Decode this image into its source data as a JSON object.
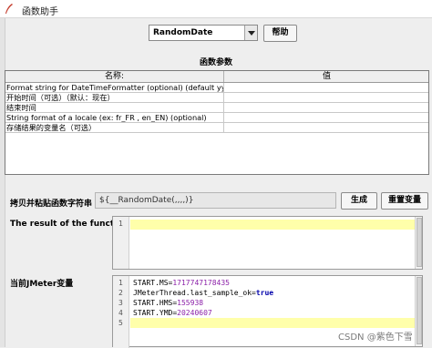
{
  "window": {
    "title": "函数助手"
  },
  "function_selector": {
    "selected": "RandomDate",
    "help_label": "帮助"
  },
  "params": {
    "heading": "函数参数",
    "columns": [
      "名称:",
      "值"
    ],
    "rows": [
      {
        "name": "Format string for DateTimeFormatter (optional) (default yyyy-M...",
        "value": ""
      },
      {
        "name": "开始时间（可选）（默认：现在）",
        "value": ""
      },
      {
        "name": "结束时间",
        "value": ""
      },
      {
        "name": "String format of a locale (ex: fr_FR , en_EN) (optional)",
        "value": ""
      },
      {
        "name": "存储结果的变量名（可选）",
        "value": ""
      }
    ]
  },
  "copy": {
    "label": "拷贝并粘贴函数字符串",
    "value": "${__RandomDate(,,,,)}",
    "generate_label": "生成",
    "reset_label": "重置变量"
  },
  "result": {
    "label": "The result of the function is",
    "line_numbers": [
      "1"
    ],
    "lines": [
      ""
    ]
  },
  "vars": {
    "label": "当前JMeter变量",
    "line_numbers": [
      "1",
      "2",
      "3",
      "4",
      "5"
    ],
    "lines": [
      {
        "key": "START.MS=",
        "value": "1717747178435"
      },
      {
        "key": "JMeterThread.last_sample_ok=",
        "value": "true"
      },
      {
        "key": "START.HMS=",
        "value": "155938"
      },
      {
        "key": "START.YMD=",
        "value": "20240607"
      },
      {
        "key": "",
        "value": ""
      }
    ]
  },
  "watermark": "CSDN @紫色下雪"
}
